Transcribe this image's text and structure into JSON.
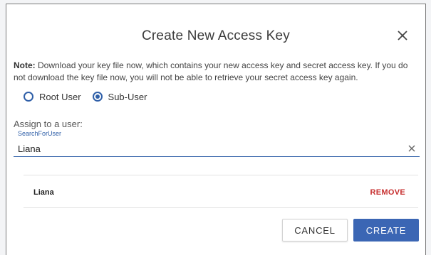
{
  "dialog": {
    "title": "Create New Access Key",
    "close_icon": "close-icon"
  },
  "note": {
    "label": "Note:",
    "text": " Download your key file now, which contains your new access key and secret access key. If you do not download the key file now, you will not be able to retrieve your secret access key again."
  },
  "user_type": {
    "options": [
      {
        "label": "Root User",
        "selected": false
      },
      {
        "label": "Sub-User",
        "selected": true
      }
    ]
  },
  "assign": {
    "label": "Assign to a user:",
    "search_label": "SearchForUser",
    "search_value": "Liana",
    "clear_icon": "clear-icon"
  },
  "selected_user": {
    "name": "Liana",
    "remove_label": "REMOVE"
  },
  "actions": {
    "cancel_label": "CANCEL",
    "create_label": "CREATE"
  },
  "colors": {
    "accent": "#2f5fa8",
    "primary_button": "#3b66b4",
    "danger": "#c72f2f"
  }
}
